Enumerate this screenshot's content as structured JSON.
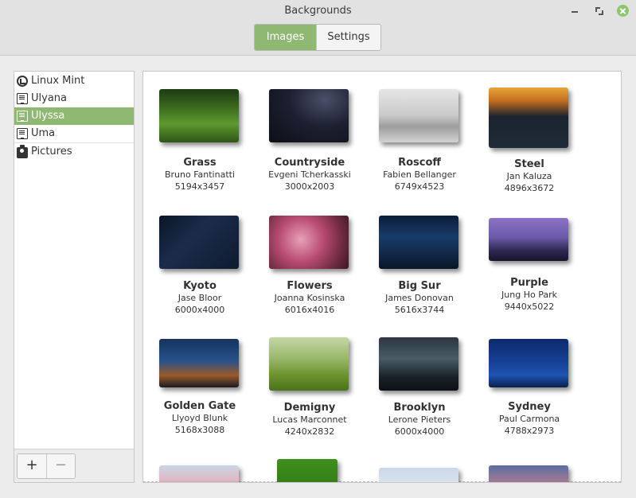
{
  "window": {
    "title": "Backgrounds",
    "top_strip_text": "...  ...... ...  ... . ...."
  },
  "tabs": [
    {
      "label": "Images",
      "selected": true
    },
    {
      "label": "Settings",
      "selected": false
    }
  ],
  "sidebar": {
    "items": [
      {
        "label": "Linux Mint",
        "icon": "linux-mint-icon"
      },
      {
        "label": "Ulyana",
        "icon": "monitor-icon"
      },
      {
        "label": "Ulyssa",
        "icon": "monitor-icon",
        "selected": true
      },
      {
        "label": "Uma",
        "icon": "monitor-icon"
      },
      {
        "label": "Pictures",
        "icon": "camera-icon"
      }
    ],
    "add_label": "+",
    "remove_label": "−"
  },
  "wallpapers": [
    {
      "name": "Grass",
      "author": "Bruno Fantinatti",
      "dims": "5194x3457",
      "theme": "grass"
    },
    {
      "name": "Countryside",
      "author": "Evgeni Tcherkasski",
      "dims": "3000x2003",
      "theme": "countryside"
    },
    {
      "name": "Roscoff",
      "author": "Fabien Bellanger",
      "dims": "6749x4523",
      "theme": "roscoff"
    },
    {
      "name": "Steel",
      "author": "Jan Kaluza",
      "dims": "4896x3672",
      "theme": "steel"
    },
    {
      "name": "Kyoto",
      "author": "Jase Bloor",
      "dims": "6000x4000",
      "theme": "kyoto"
    },
    {
      "name": "Flowers",
      "author": "Joanna Kosinska",
      "dims": "6016x4016",
      "theme": "flowers"
    },
    {
      "name": "Big Sur",
      "author": "James Donovan",
      "dims": "5616x3744",
      "theme": "bigsur"
    },
    {
      "name": "Purple",
      "author": "Jung Ho Park",
      "dims": "9440x5022",
      "theme": "purple"
    },
    {
      "name": "Golden Gate",
      "author": "Llyoyd Blunk",
      "dims": "5168x3088",
      "theme": "goldengate"
    },
    {
      "name": "Demigny",
      "author": "Lucas Marconnet",
      "dims": "4240x2832",
      "theme": "demigny"
    },
    {
      "name": "Brooklyn",
      "author": "Lerone Pieters",
      "dims": "6000x4000",
      "theme": "brooklyn"
    },
    {
      "name": "Sydney",
      "author": "Paul Carmona",
      "dims": "4788x2973",
      "theme": "sydney"
    },
    {
      "name": "",
      "author": "",
      "dims": "",
      "theme": "pinkblossom"
    },
    {
      "name": "",
      "author": "",
      "dims": "",
      "theme": "green"
    },
    {
      "name": "",
      "author": "",
      "dims": "",
      "theme": "pale"
    },
    {
      "name": "",
      "author": "",
      "dims": "",
      "theme": "dusk"
    }
  ],
  "colors": {
    "accent": "#8fb872",
    "close_button": "#8cc56a"
  }
}
